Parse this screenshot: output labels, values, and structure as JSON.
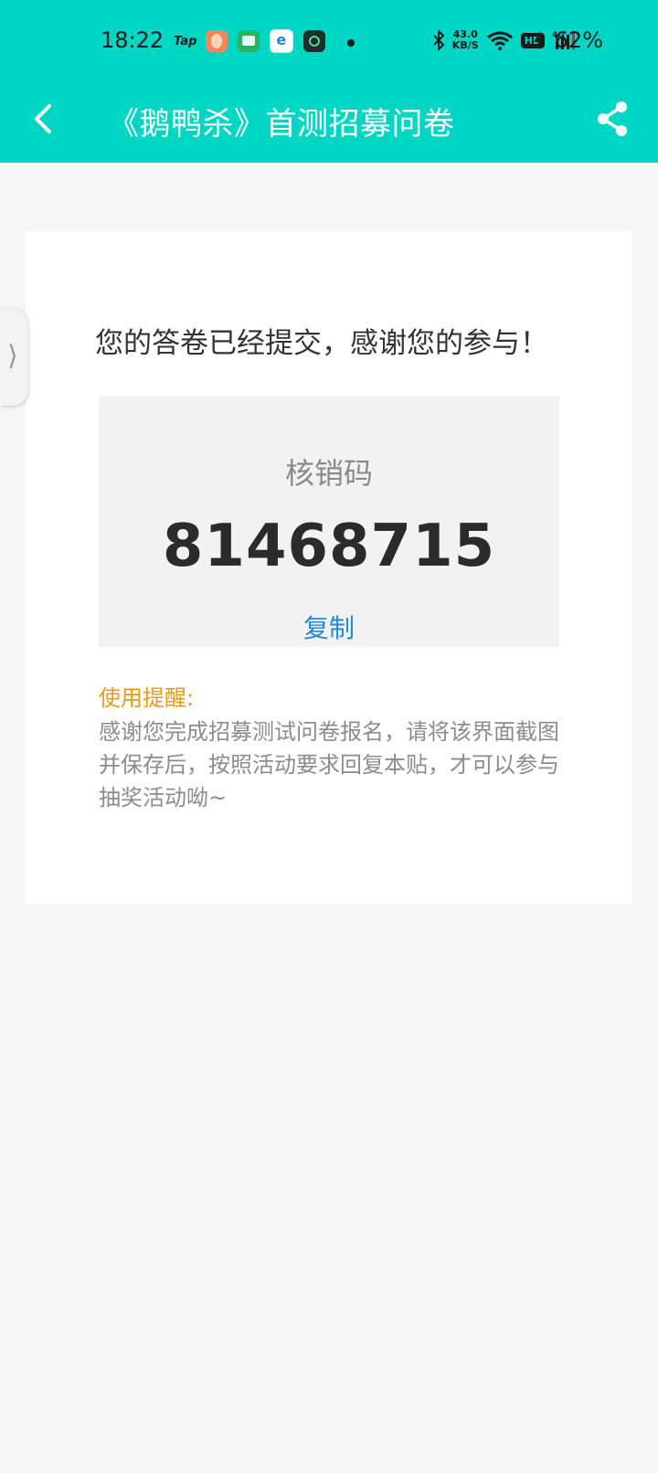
{
  "status_bar": {
    "time": "18:22",
    "tap_label": "Tap",
    "net_speed_value": "43.0",
    "net_speed_unit": "KB/S",
    "hd_label": "HD",
    "network_label": "4G",
    "battery": "62%"
  },
  "nav": {
    "title": "《鹅鸭杀》首测招募问卷"
  },
  "result": {
    "message": "您的答卷已经提交，感谢您的参与！",
    "code_label": "核销码",
    "code_value": "81468715",
    "copy_label": "复制"
  },
  "tip": {
    "title": "使用提醒:",
    "text": "感谢您完成招募测试问卷报名，请将该界面截图并保存后，按照活动要求回复本贴，才可以参与抽奖活动呦~"
  },
  "side_tab": {
    "glyph": "⟩"
  },
  "colors": {
    "header": "#00d6c4",
    "link": "#1f8ad8",
    "tip_title": "#e69b17"
  }
}
